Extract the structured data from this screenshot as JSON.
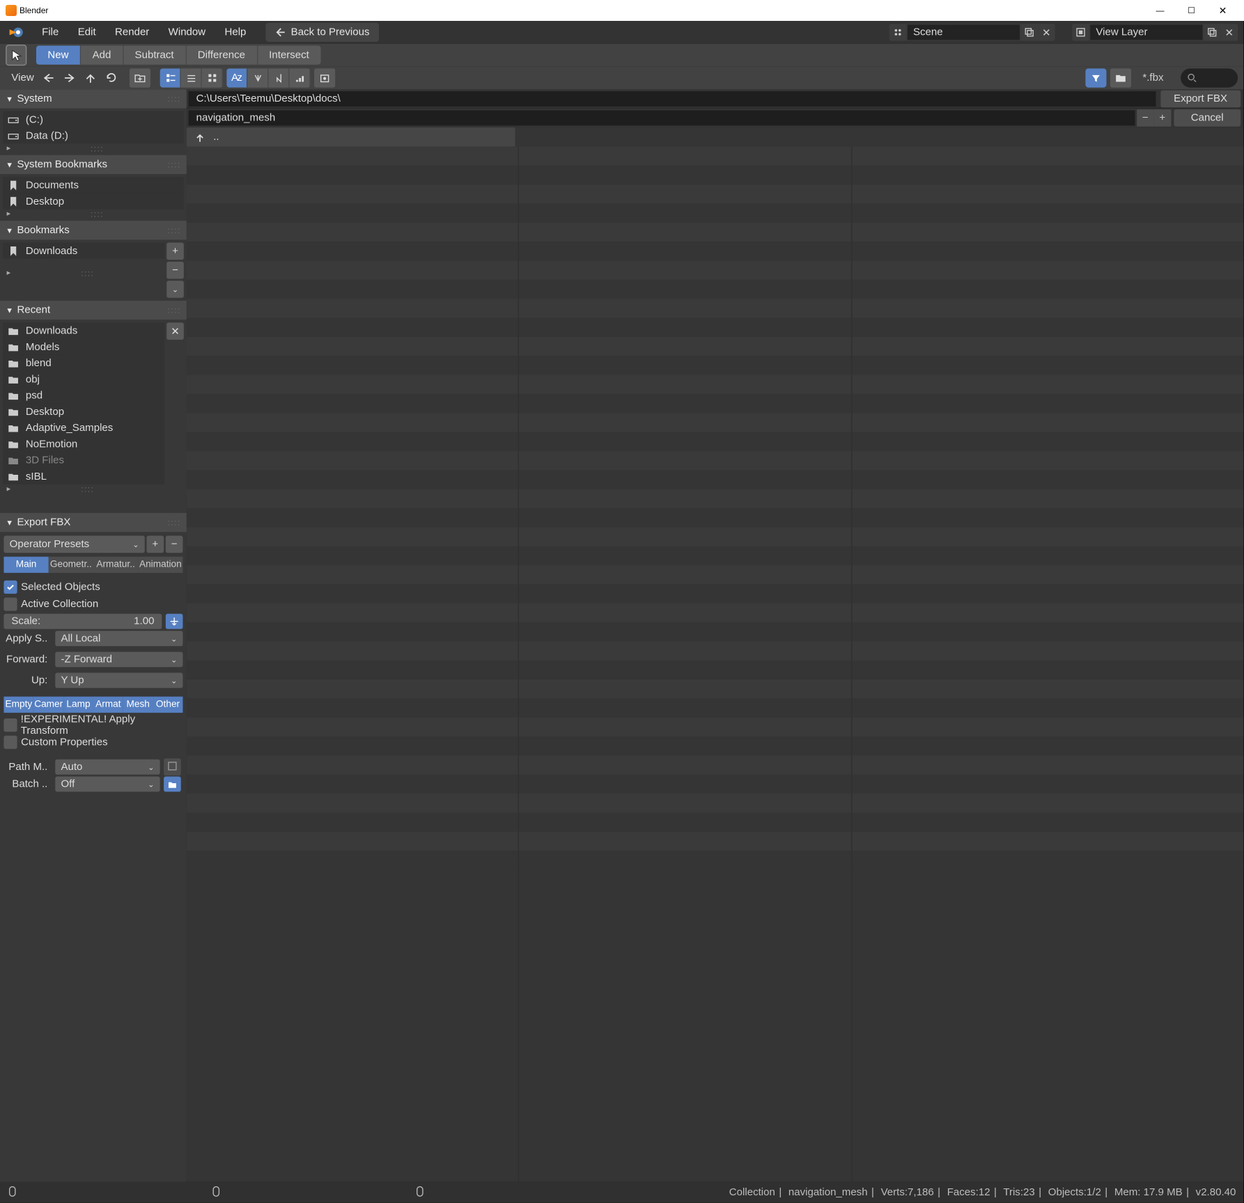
{
  "window": {
    "title": "Blender"
  },
  "menubar": {
    "items": [
      "File",
      "Edit",
      "Render",
      "Window",
      "Help"
    ],
    "back_prev": "Back to Previous",
    "scene_label": "Scene",
    "viewlayer_label": "View Layer"
  },
  "toolbar": {
    "ops": [
      "New",
      "Add",
      "Subtract",
      "Difference",
      "Intersect"
    ]
  },
  "header": {
    "view_label": "View",
    "ext_label": "*.fbx"
  },
  "path_row": {
    "path": "C:\\Users\\Teemu\\Desktop\\docs\\",
    "export_btn": "Export FBX"
  },
  "filename_row": {
    "filename": "navigation_mesh",
    "cancel_btn": "Cancel"
  },
  "sidebar": {
    "system": {
      "title": "System",
      "items": [
        "(C:)",
        "Data (D:)"
      ]
    },
    "system_bookmarks": {
      "title": "System Bookmarks",
      "items": [
        "Documents",
        "Desktop"
      ]
    },
    "bookmarks": {
      "title": "Bookmarks",
      "items": [
        "Downloads"
      ]
    },
    "recent": {
      "title": "Recent",
      "items": [
        "Downloads",
        "Models",
        "blend",
        "obj",
        "psd",
        "Desktop",
        "Adaptive_Samples",
        "NoEmotion",
        "3D Files",
        "sIBL"
      ]
    },
    "export": {
      "title": "Export FBX",
      "presets_label": "Operator Presets",
      "tabs": [
        "Main",
        "Geometr..",
        "Armatur..",
        "Animation"
      ],
      "selected_objects": "Selected Objects",
      "active_collection": "Active Collection",
      "scale_label": "Scale:",
      "scale_value": "1.00",
      "apply_scale_label": "Apply S..",
      "apply_scale_value": "All Local",
      "forward_label": "Forward:",
      "forward_value": "-Z Forward",
      "up_label": "Up:",
      "up_value": "Y Up",
      "types": [
        "Empty",
        "Camer",
        "Lamp",
        "Armat",
        "Mesh",
        "Other"
      ],
      "exp_transform": "!EXPERIMENTAL! Apply Transform",
      "custom_props": "Custom Properties",
      "path_mode_label": "Path M..",
      "path_mode_value": "Auto",
      "batch_label": "Batch ..",
      "batch_value": "Off"
    }
  },
  "file_list": {
    "up_label": ".."
  },
  "statusbar": {
    "collection": "Collection",
    "obj_name": "navigation_mesh",
    "verts": "Verts:7,186",
    "faces": "Faces:12",
    "tris": "Tris:23",
    "objects": "Objects:1/2",
    "mem": "Mem: 17.9 MB",
    "version": "v2.80.40"
  }
}
